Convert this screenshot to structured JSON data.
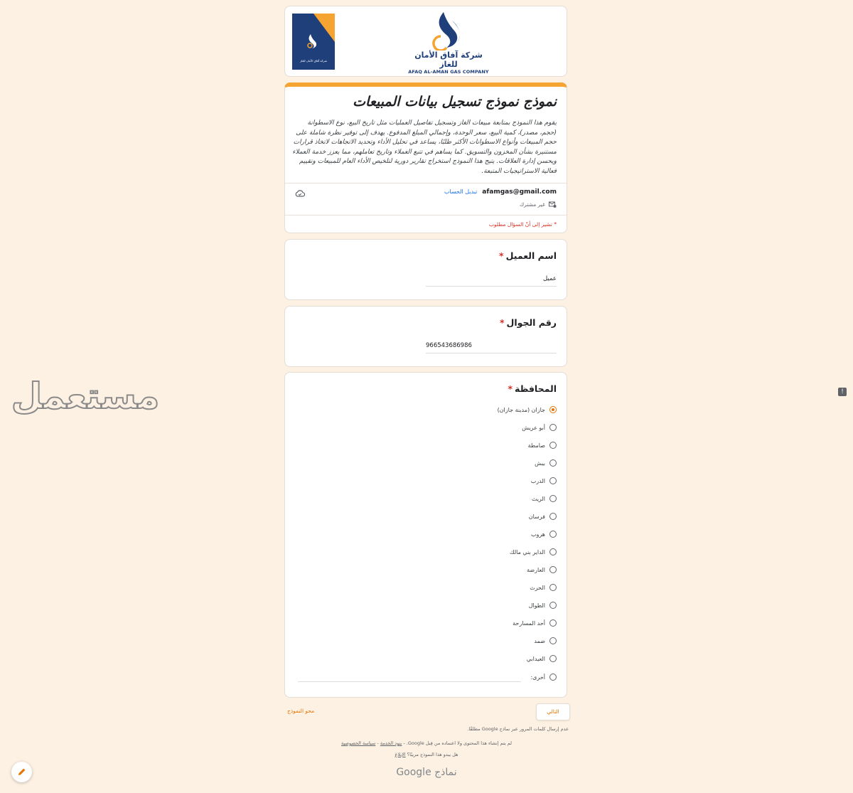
{
  "header": {
    "logo_ar": "شركة آفاق الأمان للغاز",
    "logo_en": "AFAQ AL-AMAN GAS COMPANY",
    "small_logo_text": "شركة آفاق الأمان للغاز"
  },
  "form": {
    "title": "نموذج نموذج تسجيل بيانات المبيعات",
    "description": "يقوم هذا النموذج بمتابعة مبيعات الغاز وتسجيل تفاصيل العمليات مثل تاريخ البيع، نوع الاسطوانة (حجم، مصدر)، كمية البيع، سعر الوحدة، وإجمالي المبلغ المدفوع. يهدف إلى توفير نظرة شاملة على حجم المبيعات وأنواع الاسطوانات الأكثر طلبًا، يساعد في تحليل الأداء وتحديد الاتجاهات لاتخاذ قرارات مستنيرة بشأن المخزون والتسويق. كما يساهم في تتبع العملاء وتاريخ تعاملهم، مما يعزز خدمة العملاء ويحسن إدارة العلاقات. يتيح هذا النموذج استخراج تقارير دورية لتلخيص الأداء العام للمبيعات وتقييم فعالية الاستراتيجيات المتبعة.",
    "email": "afamgas@gmail.com",
    "switch_account": "تبديل الحساب",
    "not_shared": "غير مشترك",
    "required_note": "* تشير إلى أنّ السؤال مطلوب"
  },
  "questions": {
    "name": {
      "label": "اسم العميل",
      "star": "*",
      "value": "عميل"
    },
    "phone": {
      "label": "رقم الجوال",
      "star": "*",
      "value": "966543686986"
    },
    "governorate": {
      "label": "المحافظة",
      "star": "*",
      "selected_index": 0,
      "options": [
        "جازان (مدينة جازان)",
        "أبو عريش",
        "صامطة",
        "بيش",
        "الدرب",
        "الريث",
        "فرسان",
        "هروب",
        "الداير بني مالك",
        "العارضة",
        "الحرث",
        "الطوال",
        "أحد المسارحة",
        "ضمد",
        "العيدابي",
        "أخرى:"
      ]
    }
  },
  "footer": {
    "next": "التالي",
    "clear": "محو النموذج",
    "password_note": "عدم إرسال كلمات المرور عبر نماذج Google مطلقًا.",
    "disclaimer": "لم يتم إنشاء هذا المحتوى ولا اعتماده من قِبل Google. -",
    "terms": "بنود الخدمة",
    "privacy": "سياسة الخصوصية",
    "suspicious": "هل يبدو هذا النموذج مريبًا؟",
    "report": "الإبلاغ",
    "brand_google": "Google",
    "brand_forms": "نماذج"
  },
  "watermark": "مستعمل",
  "colors": {
    "accent": "#f5a331",
    "brand_navy": "#1f3f7a",
    "required": "#d93025",
    "background": "#fdf1e3"
  }
}
